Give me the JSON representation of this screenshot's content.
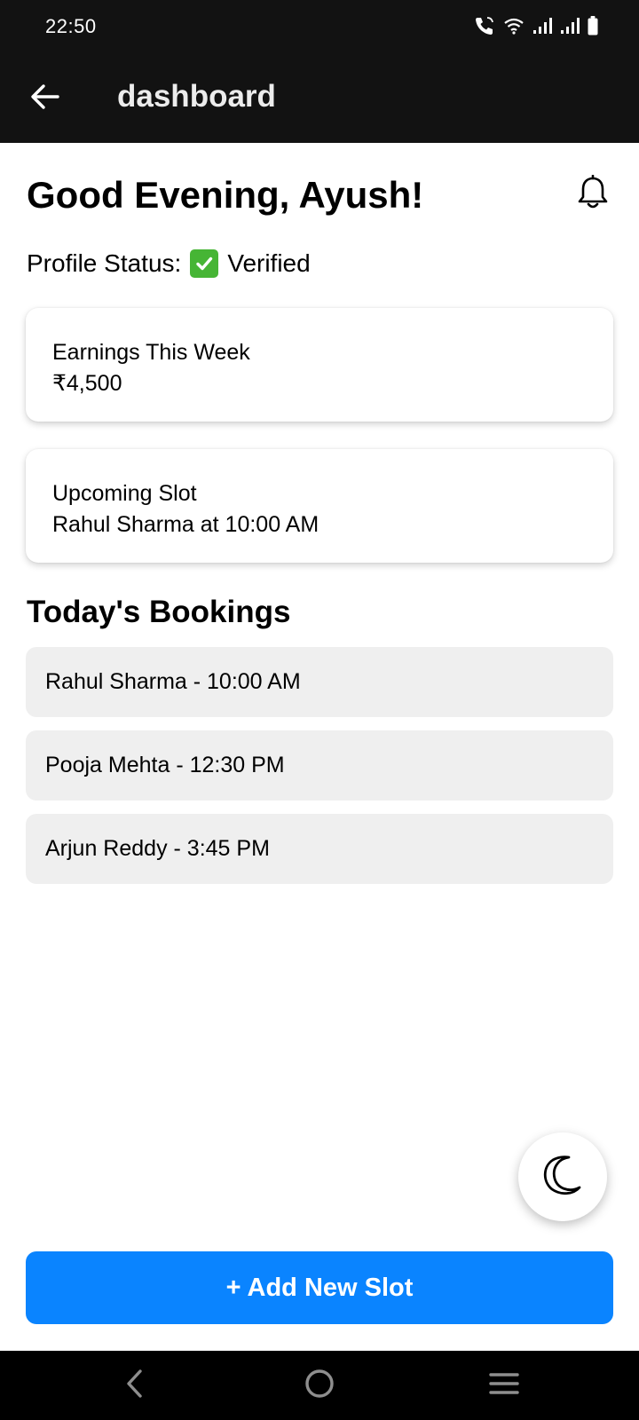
{
  "status_bar": {
    "time": "22:50",
    "icons": [
      "call-icon",
      "wifi-icon",
      "signal-icon",
      "signal-icon",
      "battery-icon"
    ]
  },
  "app_bar": {
    "title": "dashboard",
    "back_icon": "arrow-left-icon"
  },
  "header": {
    "greeting": "Good Evening, Ayush!",
    "notification_icon": "bell-icon"
  },
  "profile": {
    "label": "Profile Status:",
    "status": "Verified",
    "status_icon": "check-mark-button-icon"
  },
  "cards": {
    "earnings": {
      "label": "Earnings This Week",
      "value": "₹4,500"
    },
    "upcoming": {
      "label": "Upcoming Slot",
      "value": "Rahul Sharma at 10:00 AM"
    }
  },
  "bookings": {
    "title": "Today's Bookings",
    "items": [
      "Rahul Sharma - 10:00 AM",
      "Pooja Mehta - 12:30 PM",
      "Arjun Reddy - 3:45 PM"
    ]
  },
  "fab": {
    "icon": "moon-icon"
  },
  "primary_action": {
    "label": "+ Add New Slot",
    "color": "#0a84ff"
  },
  "system_nav": {
    "icons": [
      "nav-back-icon",
      "home-icon",
      "recents-icon"
    ]
  }
}
